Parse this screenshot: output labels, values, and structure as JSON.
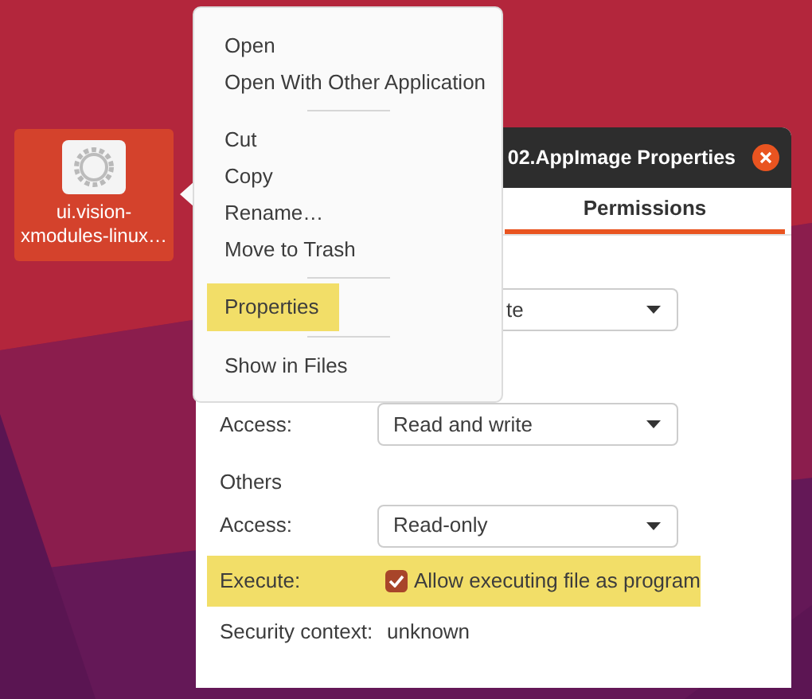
{
  "desktop_icon": {
    "label": "ui.vision-xmodules-linux…",
    "selected": true
  },
  "context_menu": {
    "items": [
      {
        "kind": "item",
        "label": "Open",
        "highlighted": false
      },
      {
        "kind": "item",
        "label": "Open With Other Application",
        "highlighted": false
      },
      {
        "kind": "separator"
      },
      {
        "kind": "item",
        "label": "Cut",
        "highlighted": false
      },
      {
        "kind": "item",
        "label": "Copy",
        "highlighted": false
      },
      {
        "kind": "item",
        "label": "Rename…",
        "highlighted": false
      },
      {
        "kind": "item",
        "label": "Move to Trash",
        "highlighted": false
      },
      {
        "kind": "separator"
      },
      {
        "kind": "item",
        "label": "Properties",
        "highlighted": true
      },
      {
        "kind": "separator"
      },
      {
        "kind": "item",
        "label": "Show in Files",
        "highlighted": false
      }
    ]
  },
  "dialog": {
    "title": "02.AppImage Properties",
    "tabs": [
      {
        "label": "Permissions",
        "selected": true
      }
    ],
    "rows": [
      {
        "kind": "partial_dropdown",
        "value": "te"
      },
      {
        "kind": "dropdown",
        "label": "Access:",
        "value": "Read and write"
      },
      {
        "kind": "heading",
        "label": "Others"
      },
      {
        "kind": "dropdown",
        "label": "Access:",
        "value": "Read-only"
      },
      {
        "kind": "checkbox",
        "label": "Execute:",
        "text": "Allow executing file as program",
        "checked": true,
        "highlighted": true
      },
      {
        "kind": "text",
        "label": "Security context:",
        "value": "unknown"
      }
    ]
  }
}
